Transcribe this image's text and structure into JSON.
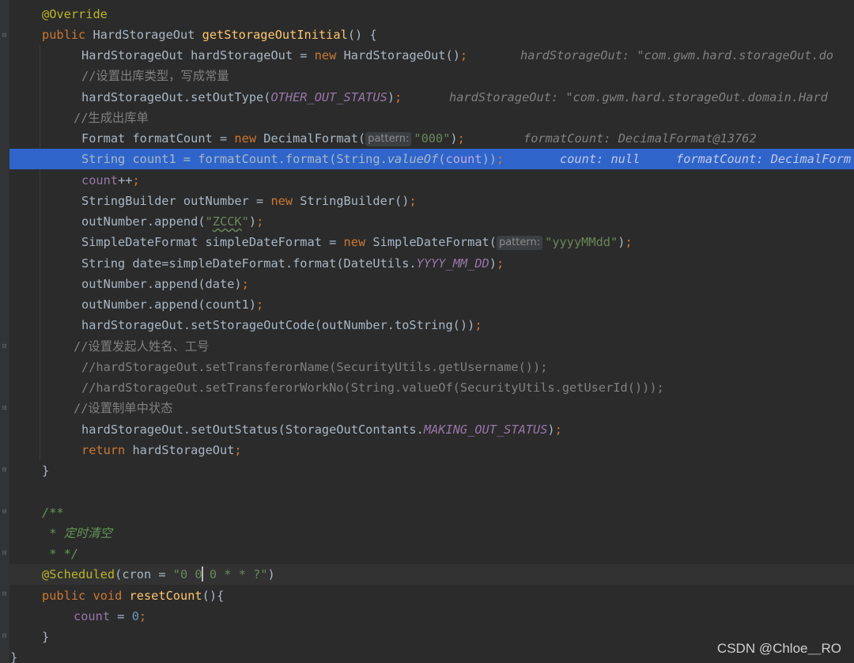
{
  "l1": {
    "a": "@Override"
  },
  "l2": {
    "a": "public",
    "b": " HardStorageOut ",
    "c": "getStorageOutInitial",
    "d": "() {"
  },
  "l3": {
    "a": "HardStorageOut hardStorageOut = ",
    "b": "new",
    "c": " HardStorageOut()",
    "d": ";",
    "e": "hardStorageOut: \"com.gwm.hard.storageOut.do"
  },
  "l4": {
    "a": "//设置出库类型，写成常量"
  },
  "l5": {
    "a": "hardStorageOut.setOutType(",
    "b": "OTHER_OUT_STATUS",
    "c": ")",
    "d": ";",
    "e": "hardStorageOut: \"com.gwm.hard.storageOut.domain.Hard"
  },
  "l6": {
    "a": "//生成出库单"
  },
  "l7": {
    "a": "Format formatCount = ",
    "b": "new",
    "c": " DecimalFormat(",
    "hint": "pattern:",
    "d": "\"000\"",
    "e": ")",
    "f": ";",
    "g": "formatCount: DecimalFormat@13762"
  },
  "l8": {
    "a": "String count1 = formatCount.format(String.",
    "b": "valueOf",
    "c": "(",
    "d": "count",
    "e": "))",
    "f": ";",
    "g": "count: null",
    "h": "formatCount: DecimalForm"
  },
  "l9": {
    "a": "count",
    "b": "++",
    "c": ";"
  },
  "l10": {
    "a": "StringBuilder outNumber = ",
    "b": "new",
    "c": " StringBuilder()",
    "d": ";"
  },
  "l11": {
    "a": "outNumber.append(",
    "b": "\"",
    "c": "ZCCK",
    "d": "\"",
    "e": ")",
    "f": ";"
  },
  "l12": {
    "a": "SimpleDateFormat simpleDateFormat = ",
    "b": "new",
    "c": " SimpleDateFormat(",
    "hint": "pattern:",
    "d": "\"yyyyMMdd\"",
    "e": ")",
    "f": ";"
  },
  "l13": {
    "a": "String date=simpleDateFormat.format(DateUtils.",
    "b": "YYYY_MM_DD",
    "c": ")",
    "d": ";"
  },
  "l14": {
    "a": "outNumber.append(date)",
    "b": ";"
  },
  "l15": {
    "a": "outNumber.append(count1)",
    "b": ";"
  },
  "l16": {
    "a": "hardStorageOut.setStorageOutCode(outNumber.toString())",
    "b": ";"
  },
  "l17": {
    "a": "//设置发起人姓名、工号"
  },
  "l18": {
    "a": "//hardStorageOut.setTransferorName(SecurityUtils.getUsername());"
  },
  "l19": {
    "a": "//hardStorageOut.setTransferorWorkNo(String.valueOf(SecurityUtils.getUserId()));"
  },
  "l20": {
    "a": "//设置制单中状态"
  },
  "l21": {
    "a": "hardStorageOut.setOutStatus(StorageOutContants.",
    "b": "MAKING_OUT_STATUS",
    "c": ")",
    "d": ";"
  },
  "l22": {
    "a": "return",
    "b": " hardStorageOut",
    "c": ";"
  },
  "l23": {
    "a": "}"
  },
  "l24": {
    "a": "/**"
  },
  "l25": {
    "a": " * 定时清空"
  },
  "l26": {
    "a": " * */"
  },
  "l27": {
    "a": "@Scheduled",
    "b": "(cron = ",
    "c": "\"0 0",
    "d": " 0 * * ?\"",
    "e": ")"
  },
  "l28": {
    "a": "public",
    "b": " ",
    "c": "void",
    "d": " ",
    "e": "resetCount",
    "f": "(){"
  },
  "l29": {
    "a": "count",
    "b": " = ",
    "c": "0",
    "d": ";"
  },
  "l30": {
    "a": "}"
  },
  "l31": {
    "a": "}"
  },
  "watermark": "CSDN @Chloe＿RO",
  "colors": {
    "background": "#2b2b2b",
    "selection": "#2f65ca",
    "keyword": "#cc7832",
    "string": "#6a8759",
    "function": "#ffc66d",
    "field": "#9876aa"
  },
  "icons": [
    "fold-marker-icon",
    "text-caret"
  ]
}
